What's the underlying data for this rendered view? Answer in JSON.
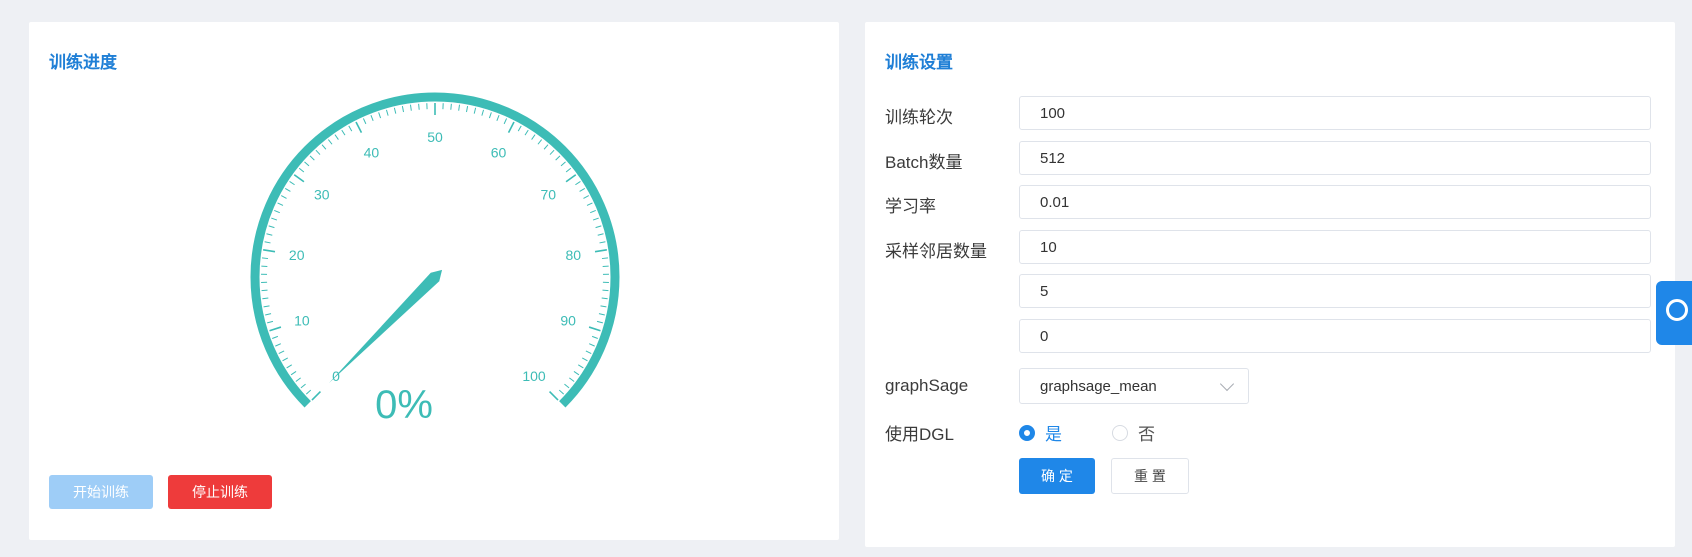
{
  "progress_panel": {
    "title": "训练进度",
    "gauge": {
      "min": 0,
      "max": 100,
      "ticks": [
        "0",
        "10",
        "20",
        "30",
        "40",
        "50",
        "60",
        "70",
        "80",
        "90",
        "100"
      ],
      "value": 0,
      "display": "0%",
      "color": "#3dbcb6"
    },
    "start_button": "开始训练",
    "stop_button": "停止训练"
  },
  "settings_panel": {
    "title": "训练设置",
    "fields": {
      "epochs": {
        "label": "训练轮次",
        "value": "100"
      },
      "batch": {
        "label": "Batch数量",
        "value": "512"
      },
      "lr": {
        "label": "学习率",
        "value": "0.01"
      },
      "neighbors": {
        "label": "采样邻居数量",
        "values": [
          "10",
          "5",
          "0"
        ]
      },
      "graphsage": {
        "label": "graphSage",
        "value": "graphsage_mean"
      },
      "use_dgl": {
        "label": "使用DGL",
        "options": [
          "是",
          "否"
        ],
        "selected": "是"
      }
    },
    "ok_button": "确 定",
    "reset_button": "重 置"
  },
  "colors": {
    "accent": "#1f87e8",
    "danger": "#ee3b3b",
    "gauge": "#3dbcb6"
  },
  "float_tab_icon": "settings-ring-icon"
}
